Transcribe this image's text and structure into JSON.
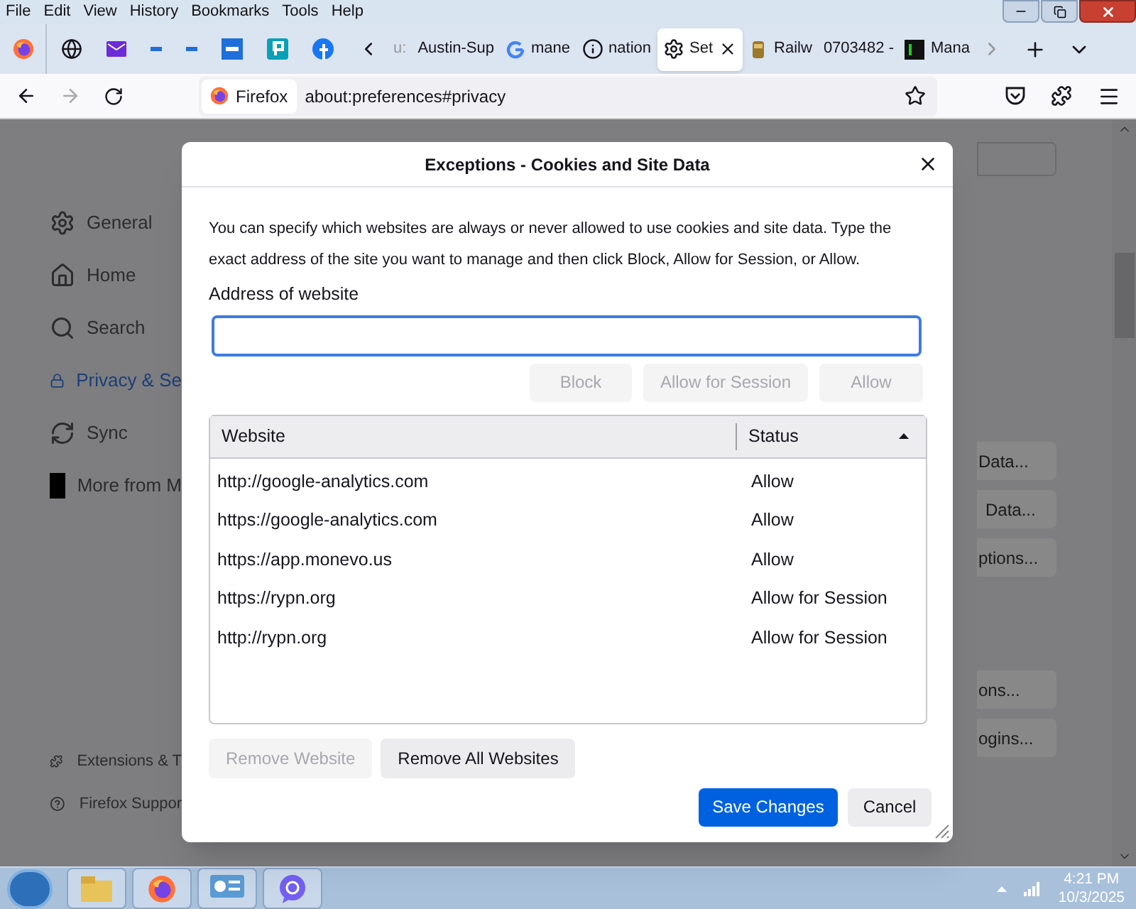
{
  "menu_bar": [
    "File",
    "Edit",
    "View",
    "History",
    "Bookmarks",
    "Tools",
    "Help"
  ],
  "tabs": [
    {
      "label": "u:",
      "selected": false
    },
    {
      "label": "Austin-Sup",
      "selected": false
    },
    {
      "label": "mane",
      "selected": false
    },
    {
      "label": "nation",
      "selected": false
    },
    {
      "label": "Set",
      "selected": true
    },
    {
      "label": "Railw",
      "selected": false
    },
    {
      "label": "0703482 -",
      "selected": false
    },
    {
      "label": "Mana",
      "selected": false
    }
  ],
  "address_bar": {
    "identity": "Firefox",
    "url": "about:preferences#privacy"
  },
  "sidebar": {
    "items": [
      {
        "label": "General",
        "selected": false
      },
      {
        "label": "Home",
        "selected": false
      },
      {
        "label": "Search",
        "selected": false
      },
      {
        "label": "Privacy & Se",
        "selected": true
      },
      {
        "label": "Sync",
        "selected": false
      },
      {
        "label": "More from M",
        "selected": false
      }
    ],
    "footer": [
      "Extensions & T",
      "Firefox Suppor"
    ]
  },
  "page_buttons": [
    "Data...",
    "Data...",
    "ptions...",
    "ons...",
    "ogins..."
  ],
  "dialog": {
    "title": "Exceptions - Cookies and Site Data",
    "description": "You can specify which websites are always or never allowed to use cookies and site data. Type the exact address of the site you want to manage and then click Block, Allow for Session, or Allow.",
    "address_label": "Address of website",
    "action_buttons": [
      {
        "label": "Block",
        "disabled": true
      },
      {
        "label": "Allow for Session",
        "disabled": true
      },
      {
        "label": "Allow",
        "disabled": true
      }
    ],
    "table": {
      "columns": [
        "Website",
        "Status"
      ],
      "rows": [
        {
          "website": "http://google-analytics.com",
          "status": "Allow"
        },
        {
          "website": "https://google-analytics.com",
          "status": "Allow"
        },
        {
          "website": "https://app.monevo.us",
          "status": "Allow"
        },
        {
          "website": "https://rypn.org",
          "status": "Allow for Session"
        },
        {
          "website": "http://rypn.org",
          "status": "Allow for Session"
        }
      ]
    },
    "remove_buttons": [
      {
        "label": "Remove Website",
        "disabled": true
      },
      {
        "label": "Remove All Websites",
        "disabled": false
      }
    ],
    "footer_buttons": [
      {
        "label": "Save Changes",
        "kind": "primary"
      },
      {
        "label": "Cancel",
        "kind": "secondary"
      }
    ]
  },
  "taskbar": {
    "time": "4:21 PM",
    "date": "10/3/2025"
  }
}
